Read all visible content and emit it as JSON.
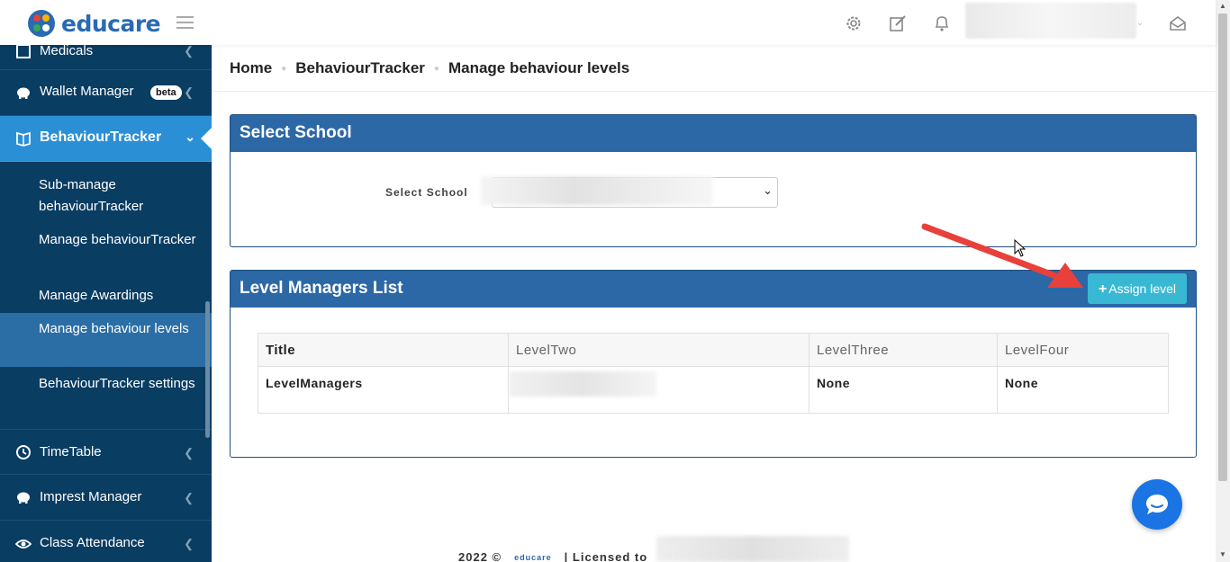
{
  "brand": {
    "name": "educare"
  },
  "sidebar": {
    "medicals_label": "Medicals",
    "wallet_label": "Wallet Manager",
    "wallet_badge": "beta",
    "behaviour_label": "BehaviourTracker",
    "sub_items": [
      {
        "label": "Sub-manage behaviourTracker"
      },
      {
        "label": "Manage behaviourTracker"
      },
      {
        "label": "Manage Awardings"
      },
      {
        "label": "Manage behaviour levels"
      },
      {
        "label": "BehaviourTracker settings"
      }
    ],
    "timetable_label": "TimeTable",
    "imprest_label": "Imprest Manager",
    "attendance_label": "Class Attendance"
  },
  "breadcrumb": {
    "home": "Home",
    "section": "BehaviourTracker",
    "current": "Manage behaviour levels"
  },
  "select_panel": {
    "title": "Select School",
    "field_label": "Select School"
  },
  "list_panel": {
    "title": "Level Managers List",
    "assign_button": "Assign level",
    "columns": [
      "Title",
      "LevelTwo",
      "LevelThree",
      "LevelFour"
    ],
    "rows": [
      {
        "title": "LevelManagers",
        "level_two": "",
        "level_three": "None",
        "level_four": "None"
      }
    ]
  },
  "footer": {
    "copyright": "2022 ©",
    "footer_brand": "educare",
    "licensed": "| Licensed to"
  },
  "colors": {
    "sidebar": "#0a3d62",
    "active": "#2b8fd6",
    "panel_header": "#2c67a6",
    "assign": "#39b8d4",
    "chat": "#1b74e4",
    "arrow": "#e8403a"
  }
}
